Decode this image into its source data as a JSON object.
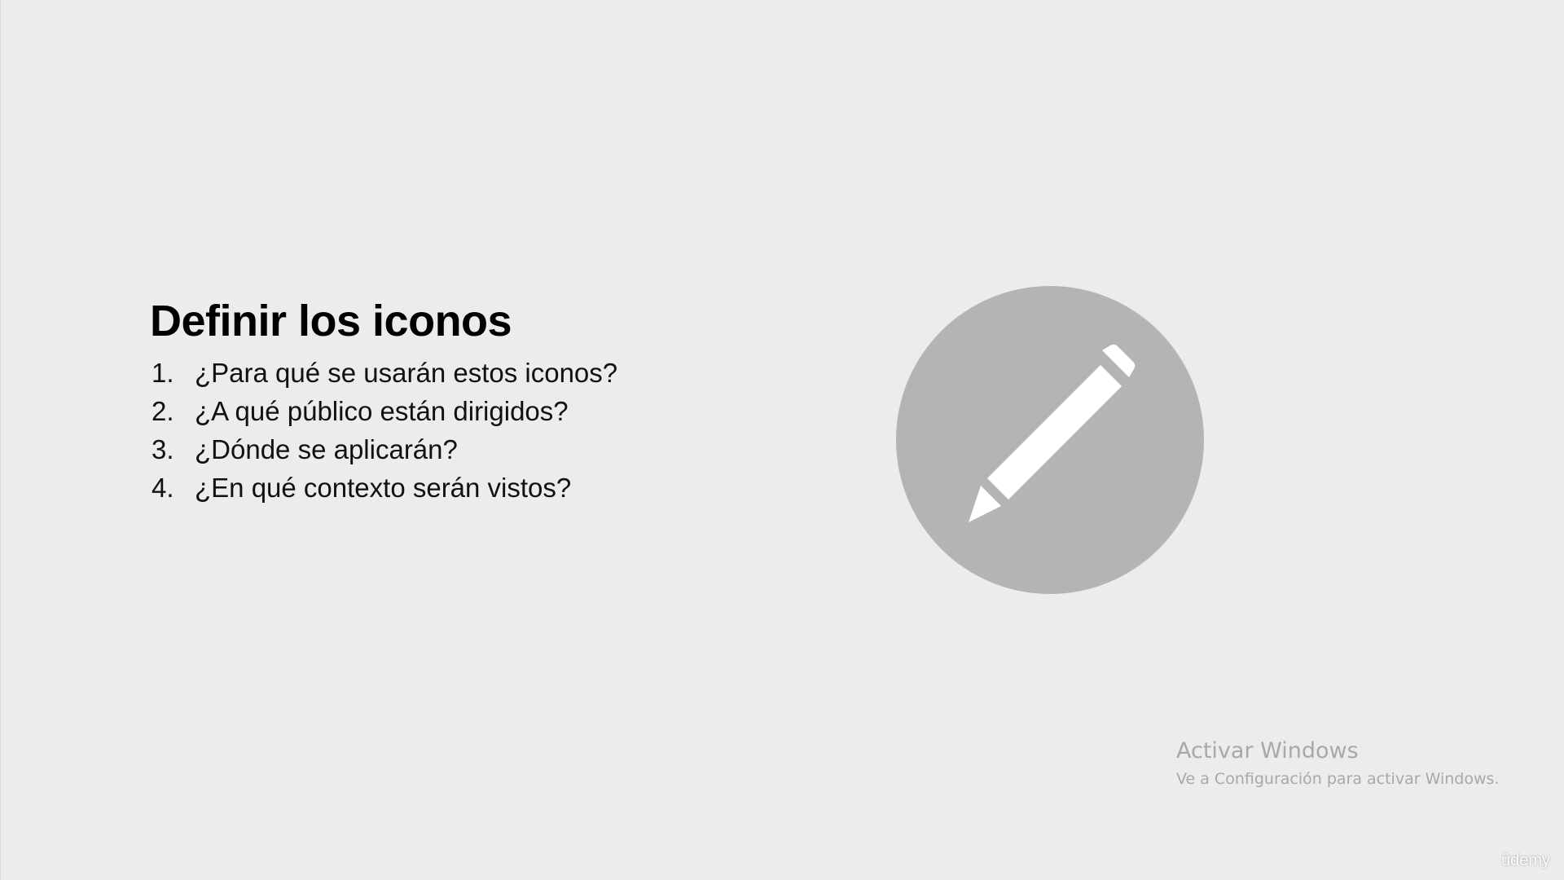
{
  "slide": {
    "title": "Definir los iconos",
    "questions": [
      {
        "number": "1.",
        "text": "¿Para qué se usarán estos iconos?"
      },
      {
        "number": "2.",
        "text": "¿A qué público están dirigidos?"
      },
      {
        "number": "3.",
        "text": "¿Dónde se aplicarán?"
      },
      {
        "number": "4.",
        "text": "¿En qué contexto serán vistos?"
      }
    ],
    "illustration": {
      "icon": "pencil-icon",
      "circle_color": "#b4b4b5",
      "pencil_color": "#ffffff"
    },
    "background_color": "#ececec"
  },
  "windows_activation": {
    "title": "Activar Windows",
    "subtitle": "Ve a Configuración para activar Windows."
  },
  "watermark": {
    "text": "ûdemy"
  }
}
